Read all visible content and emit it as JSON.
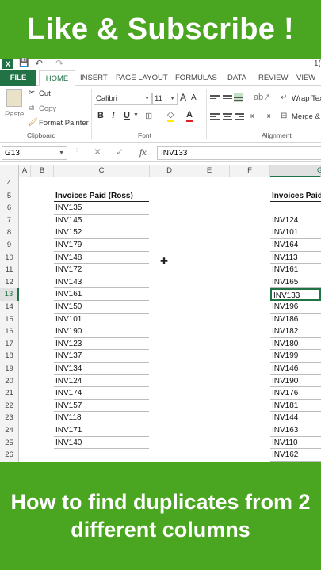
{
  "banner_top": "Like & Subscribe !",
  "banner_bottom": "How to find duplicates from 2 different columns",
  "quick_access": {
    "app_letter": "X",
    "save": "💾",
    "undo": "↶",
    "redo": "↷",
    "fragment": "1("
  },
  "tabs": [
    "FILE",
    "HOME",
    "INSERT",
    "PAGE LAYOUT",
    "FORMULAS",
    "DATA",
    "REVIEW",
    "VIEW"
  ],
  "ribbon": {
    "clipboard": {
      "paste": "Paste",
      "cut": "Cut",
      "copy": "Copy",
      "format_painter": "Format Painter",
      "label": "Clipboard"
    },
    "font": {
      "name": "Calibri",
      "size": "11",
      "grow": "A",
      "shrink": "A",
      "bold": "B",
      "italic": "I",
      "underline": "U",
      "label": "Font"
    },
    "alignment": {
      "wrap": "Wrap Tex",
      "merge": "Merge &",
      "label": "Alignment"
    }
  },
  "formula_bar": {
    "name_box": "G13",
    "cancel": "✕",
    "enter": "✓",
    "fx": "fx",
    "value": "INV133"
  },
  "columns": [
    "A",
    "B",
    "C",
    "D",
    "E",
    "F",
    "G"
  ],
  "rows": [
    "4",
    "5",
    "6",
    "7",
    "8",
    "9",
    "10",
    "11",
    "12",
    "13",
    "14",
    "15",
    "16",
    "17",
    "18",
    "19",
    "20",
    "21",
    "22",
    "23",
    "24",
    "25",
    "26"
  ],
  "column_c": {
    "header": "Invoices Paid (Ross)",
    "values": [
      "INV135",
      "INV145",
      "INV152",
      "INV179",
      "INV148",
      "INV172",
      "INV143",
      "INV161",
      "INV150",
      "INV101",
      "INV190",
      "INV123",
      "INV137",
      "INV134",
      "INV124",
      "INV174",
      "INV157",
      "INV118",
      "INV171",
      "INV140"
    ]
  },
  "column_g": {
    "header": "Invoices Paid",
    "values": [
      "INV124",
      "INV101",
      "INV164",
      "INV113",
      "INV161",
      "INV165",
      "INV133",
      "INV196",
      "INV186",
      "INV182",
      "INV180",
      "INV199",
      "INV146",
      "INV190",
      "INV176",
      "INV181",
      "INV144",
      "INV163",
      "INV110",
      "INV162"
    ]
  },
  "colors": {
    "accent": "#217346",
    "banner": "#4aa520"
  }
}
